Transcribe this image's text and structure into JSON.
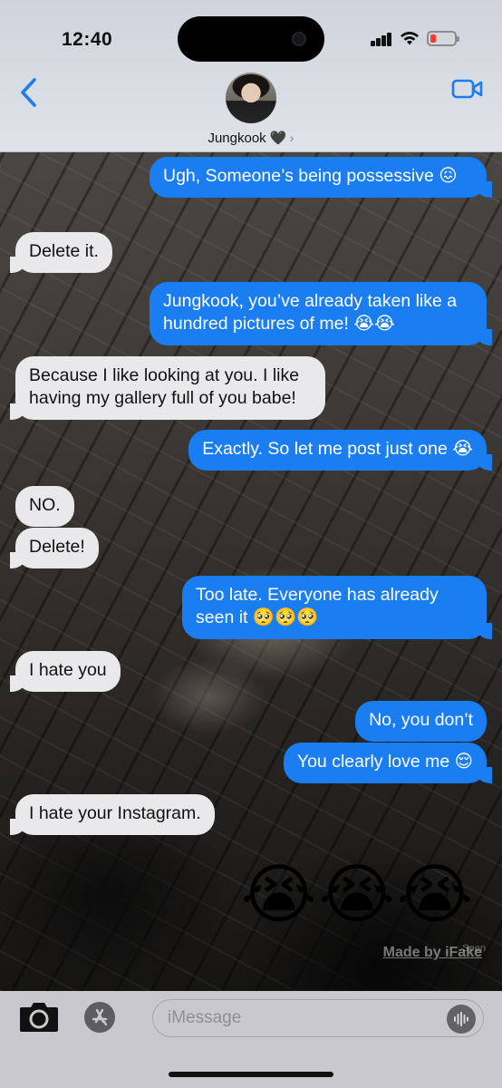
{
  "status_bar": {
    "time": "12:40",
    "battery_color": "#ff3b30"
  },
  "header": {
    "contact_name": "Jungkook 🖤",
    "chevron": "›",
    "back_icon": "chevron-left-icon",
    "video_icon": "video-camera-icon",
    "accent_color": "#1a7ef2"
  },
  "messages": [
    {
      "side": "out",
      "text": "Ugh, Someone’s being possessive 😖"
    },
    {
      "side": "in",
      "text": "Delete it."
    },
    {
      "side": "out",
      "text": "Jungkook, you’ve already taken like a hundred pictures of me! 😭😭"
    },
    {
      "side": "in",
      "text": "Because I like looking at you. I like having my gallery full of you babe!"
    },
    {
      "side": "out",
      "text": "Exactly. So let me post just one 😭"
    },
    {
      "side": "in",
      "text": "NO."
    },
    {
      "side": "in",
      "text": "Delete!"
    },
    {
      "side": "out",
      "text": "Too late. Everyone has already seen it 🥺🥺🥺"
    },
    {
      "side": "in",
      "text": "I hate you"
    },
    {
      "side": "out",
      "text": "No, you don’t"
    },
    {
      "side": "out",
      "text": "You clearly love me 😌"
    },
    {
      "side": "in",
      "text": "I hate your Instagram."
    }
  ],
  "big_emoji": "😭😭😭",
  "watermark": "Made by iFake",
  "seen_label": "Seen",
  "composer": {
    "placeholder": "iMessage",
    "value": ""
  }
}
